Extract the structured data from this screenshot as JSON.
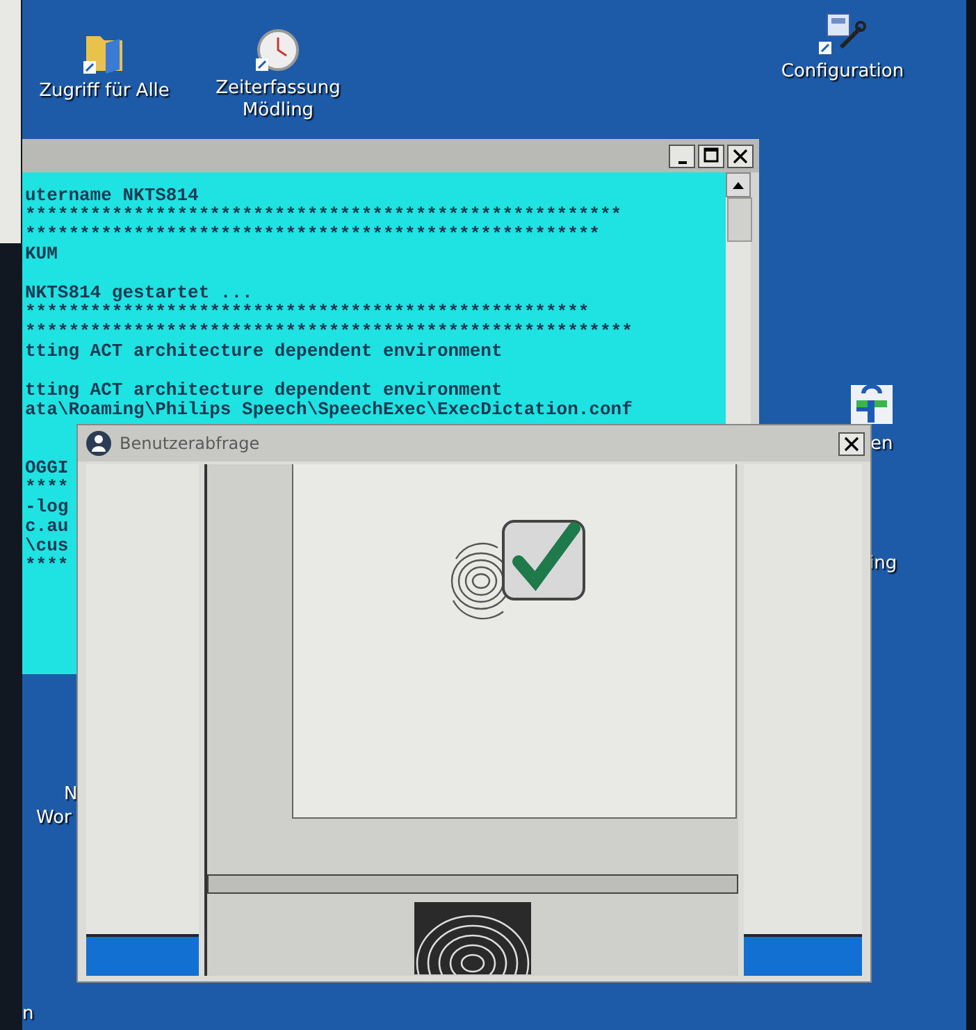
{
  "desktop": {
    "icons": [
      {
        "kind": "folder",
        "label": "Zugriff für Alle"
      },
      {
        "kind": "clock",
        "label": "Zeiterfassung Mödling"
      },
      {
        "kind": "tool",
        "label": "Configuration"
      },
      {
        "kind": "app"
      }
    ],
    "partial_labels": [
      {
        "text": "en"
      },
      {
        "text": "ing"
      },
      {
        "text": "N"
      },
      {
        "text": "Wor"
      },
      {
        "text": "n"
      }
    ]
  },
  "console": {
    "lines": [
      {
        "kind": "text",
        "text": "utername NKTS814"
      },
      {
        "kind": "text",
        "text": "*******************************************************"
      },
      {
        "kind": "text",
        "text": "*****************************************************"
      },
      {
        "kind": "text",
        "text": "KUM"
      },
      {
        "kind": "blank"
      },
      {
        "kind": "text",
        "text": "NKTS814 gestartet ..."
      },
      {
        "kind": "text",
        "text": "****************************************************"
      },
      {
        "kind": "text",
        "text": "********************************************************"
      },
      {
        "kind": "text",
        "text": "tting ACT architecture dependent environment"
      },
      {
        "kind": "blank"
      },
      {
        "kind": "text",
        "text": "tting ACT architecture dependent environment"
      },
      {
        "kind": "text",
        "text": "ata\\Roaming\\Philips Speech\\SpeechExec\\ExecDictation.conf"
      },
      {
        "kind": "blank"
      },
      {
        "kind": "blank"
      },
      {
        "kind": "text",
        "text": "OGGI"
      },
      {
        "kind": "text",
        "text": "****"
      },
      {
        "kind": "text",
        "text": "-log"
      },
      {
        "kind": "text",
        "text": "c.au"
      },
      {
        "kind": "text",
        "text": "\\cus"
      },
      {
        "kind": "text",
        "text": "****"
      }
    ]
  },
  "dialog": {
    "title": "Benutzerabfrage"
  }
}
